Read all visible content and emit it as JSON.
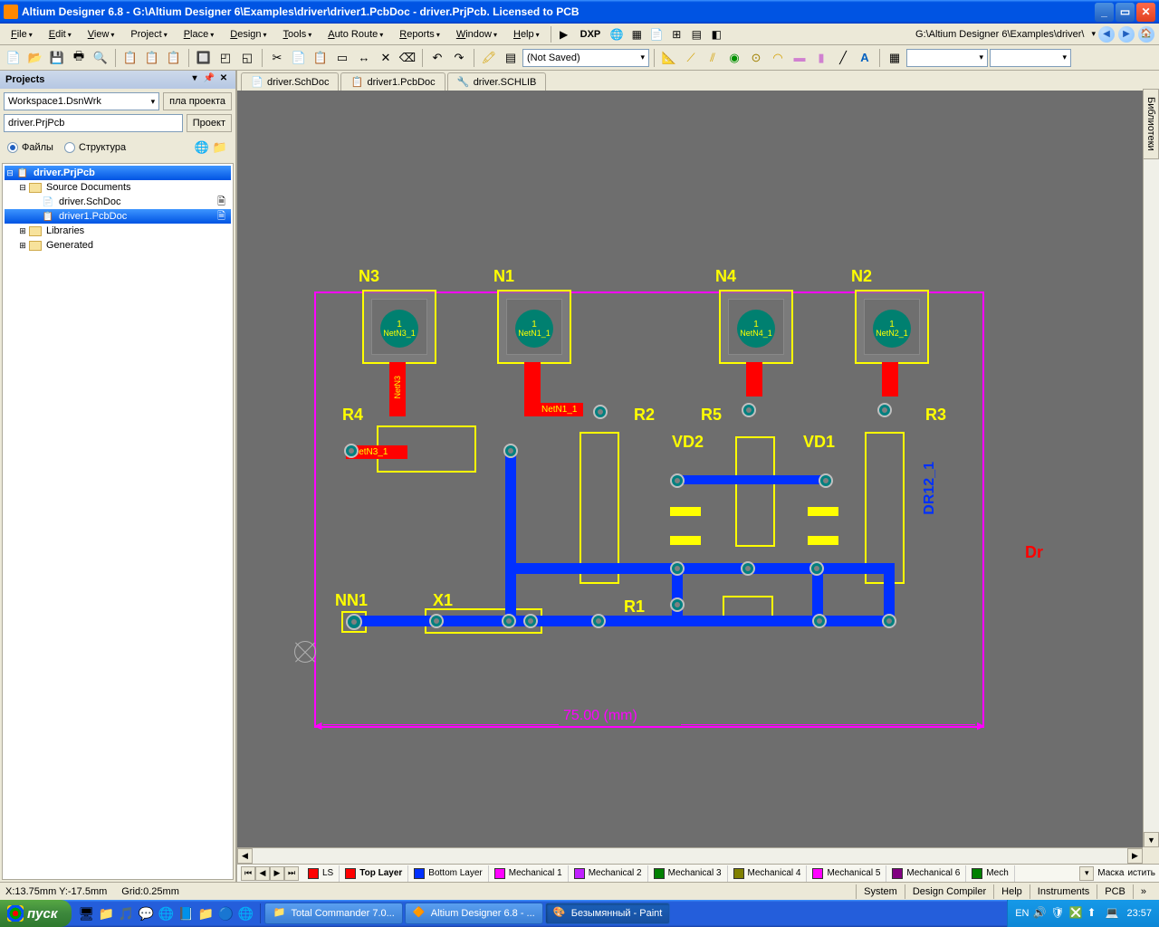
{
  "titlebar": {
    "text": "Altium Designer 6.8 - G:\\Altium Designer 6\\Examples\\driver\\driver1.PcbDoc - driver.PrjPcb. Licensed to PCB"
  },
  "menus": [
    "File",
    "Edit",
    "View",
    "Project",
    "Place",
    "Design",
    "Tools",
    "Auto Route",
    "Reports",
    "Window",
    "Help"
  ],
  "menubar_right": {
    "path": "G:\\Altium Designer 6\\Examples\\driver\\"
  },
  "dxp": "DXP",
  "toolbar2_combo": "(Not Saved)",
  "projects": {
    "title": "Projects",
    "workspace": "Workspace1.DsnWrk",
    "workspace_btn": "пла проекта",
    "project": "driver.PrjPcb",
    "project_btn": "Проект",
    "radio_files": "Файлы",
    "radio_struct": "Структура",
    "tree": {
      "root": "driver.PrjPcb",
      "nodes": [
        {
          "label": "Source Documents",
          "children": [
            "driver.SchDoc",
            "driver1.PcbDoc"
          ]
        },
        {
          "label": "Libraries"
        },
        {
          "label": "Generated"
        }
      ]
    }
  },
  "doc_tabs": [
    "driver.SchDoc",
    "driver1.PcbDoc",
    "driver.SCHLIB"
  ],
  "side_tab": "Библиотеки",
  "canvas": {
    "designators": {
      "N3": "N3",
      "N1": "N1",
      "N4": "N4",
      "N2": "N2",
      "R4": "R4",
      "R2": "R2",
      "R5": "R5",
      "R3": "R3",
      "R1": "R1",
      "VD2": "VD2",
      "VD1": "VD1",
      "NN1": "NN1",
      "X1": "X1",
      "DR12_1": "DR12_1",
      "Dr": "Dr"
    },
    "nets": {
      "NetN3_1": "NetN3_1",
      "NetN1_1": "NetN1_1",
      "NetN4_1": "NetN4_1",
      "NetN2_1": "NetN2_1",
      "NetN3": "NetN3"
    },
    "pad_label": "1",
    "dim_text": "75.00 (mm)"
  },
  "layers": {
    "current": "LS",
    "tabs": [
      {
        "name": "Top Layer",
        "color": "#ff0000",
        "active": true
      },
      {
        "name": "Bottom Layer",
        "color": "#0030ff"
      },
      {
        "name": "Mechanical 1",
        "color": "#ff00ff"
      },
      {
        "name": "Mechanical 2",
        "color": "#c020ff"
      },
      {
        "name": "Mechanical 3",
        "color": "#008000"
      },
      {
        "name": "Mechanical 4",
        "color": "#808000"
      },
      {
        "name": "Mechanical 5",
        "color": "#ff00ff"
      },
      {
        "name": "Mechanical 6",
        "color": "#800080"
      },
      {
        "name": "Mech",
        "color": "#008000"
      }
    ],
    "mask": "Маска",
    "clear": "истить"
  },
  "status": {
    "coords": "X:13.75mm Y:-17.5mm",
    "grid": "Grid:0.25mm",
    "right": [
      "System",
      "Design Compiler",
      "Help",
      "Instruments",
      "PCB"
    ]
  },
  "taskbar": {
    "start": "пуск",
    "tasks": [
      {
        "label": "Total Commander 7.0..."
      },
      {
        "label": "Altium Designer 6.8 - ..."
      },
      {
        "label": "Безымянный - Paint"
      }
    ],
    "lang": "EN",
    "time": "23:57"
  }
}
